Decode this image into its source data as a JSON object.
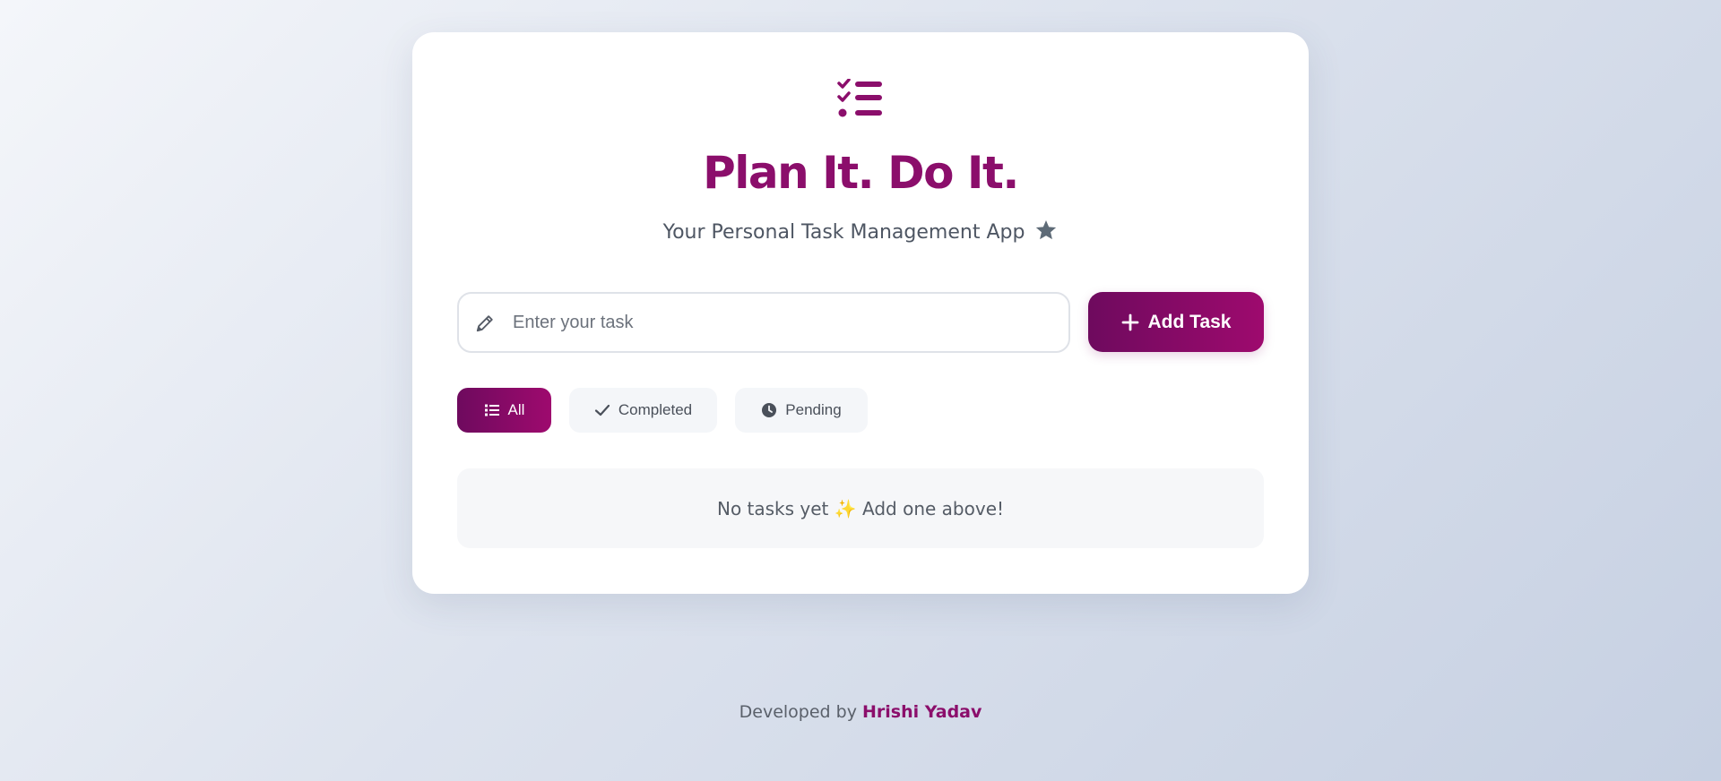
{
  "app": {
    "title": "Plan It. Do It.",
    "subtitle": "Your Personal Task Management App",
    "logo_icon": "task-list-check-icon",
    "subtitle_icon": "star-icon"
  },
  "input": {
    "value": "",
    "placeholder": "Enter your task",
    "icon": "pencil-icon"
  },
  "add_button": {
    "label": "Add Task",
    "icon": "plus-icon"
  },
  "filters": [
    {
      "label": "All",
      "icon": "list-icon",
      "active": true
    },
    {
      "label": "Completed",
      "icon": "check-icon",
      "active": false
    },
    {
      "label": "Pending",
      "icon": "clock-icon",
      "active": false
    }
  ],
  "empty_state": {
    "text": "No tasks yet ✨ Add one above!"
  },
  "footer": {
    "prefix": "Developed by",
    "author": "Hrishi Yadav"
  },
  "colors": {
    "accent": "#8b0e6b",
    "accent_gradient_start": "#6e0a5e",
    "accent_gradient_end": "#9e0a6e",
    "text_muted": "#4e5663",
    "chip_bg": "#f4f6f9"
  }
}
